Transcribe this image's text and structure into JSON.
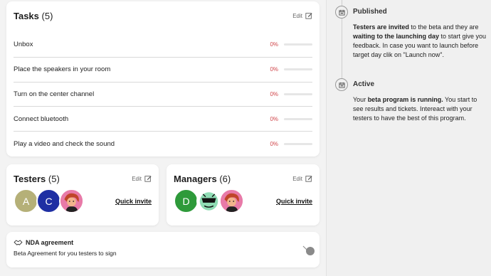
{
  "tasks": {
    "title": "Tasks",
    "count": "(5)",
    "edit_label": "Edit",
    "items": [
      {
        "label": "Unbox",
        "percent": "0%"
      },
      {
        "label": "Place the speakers in your room",
        "percent": "0%"
      },
      {
        "label": "Turn on the center channel",
        "percent": "0%"
      },
      {
        "label": "Connect bluetooth",
        "percent": "0%"
      },
      {
        "label": "Play a video and check the sound",
        "percent": "0%"
      }
    ]
  },
  "testers": {
    "title": "Testers",
    "count": "(5)",
    "edit_label": "Edit",
    "invite_label": "Quick invite",
    "avatars": [
      {
        "initial": "A",
        "color": "#b5b078"
      },
      {
        "initial": "C",
        "color": "#1f2fa3"
      }
    ]
  },
  "managers": {
    "title": "Managers",
    "count": "(6)",
    "edit_label": "Edit",
    "invite_label": "Quick invite",
    "avatars": [
      {
        "initial": "D",
        "color": "#2e9a3a"
      }
    ]
  },
  "nda": {
    "title": "NDA agreement",
    "subtitle": "Beta Agreement for you testers to sign"
  },
  "timeline": {
    "published": {
      "title": "Published",
      "p1": "Testers are invited",
      "p2": " to the beta and they are ",
      "p3": "waiting to the launching day",
      "p4": " to start give you feedback. In case you want to launch before target day clik on \"Launch now\"."
    },
    "active": {
      "title": "Active",
      "p1": "Your ",
      "p2": "beta program is running.",
      "p3": " You start to see results and tickets. Intereact with your testers to have the best of this program."
    }
  },
  "colors": {
    "percent": "#d0464b",
    "background": "#f3f3f3"
  }
}
